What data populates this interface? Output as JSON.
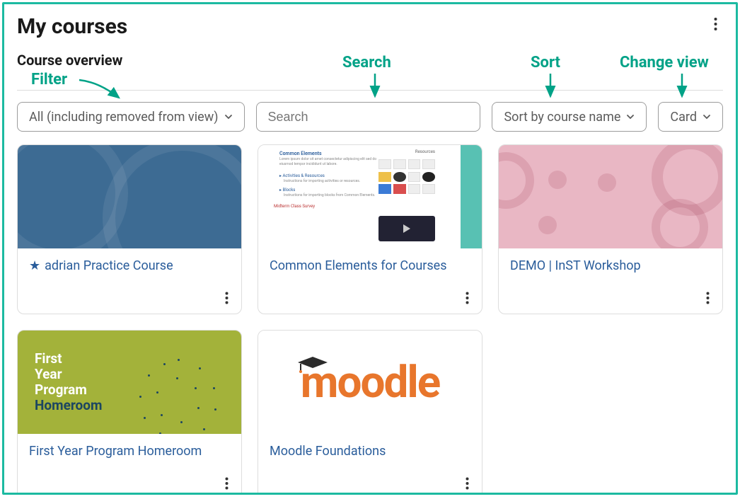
{
  "header": {
    "page_title": "My courses",
    "overview_title": "Course overview"
  },
  "controls": {
    "filter_value": "All (including removed from view)",
    "search_placeholder": "Search",
    "sort_value": "Sort by course name",
    "view_value": "Card"
  },
  "annotations": {
    "filter": "Filter",
    "search": "Search",
    "sort": "Sort",
    "view": "Change view"
  },
  "courses": [
    {
      "title": "adrian Practice Course",
      "starred": true
    },
    {
      "title": "Common Elements for Courses",
      "starred": false
    },
    {
      "title": "DEMO | InST Workshop",
      "starred": false
    },
    {
      "title": "First Year Program Homeroom",
      "starred": false
    },
    {
      "title": "Moodle Foundations",
      "starred": false
    }
  ],
  "thumb3_lines": {
    "l1": "First",
    "l2": "Year",
    "l3": "Program",
    "l4": "Homeroom"
  },
  "thumb4_text": "moodle"
}
